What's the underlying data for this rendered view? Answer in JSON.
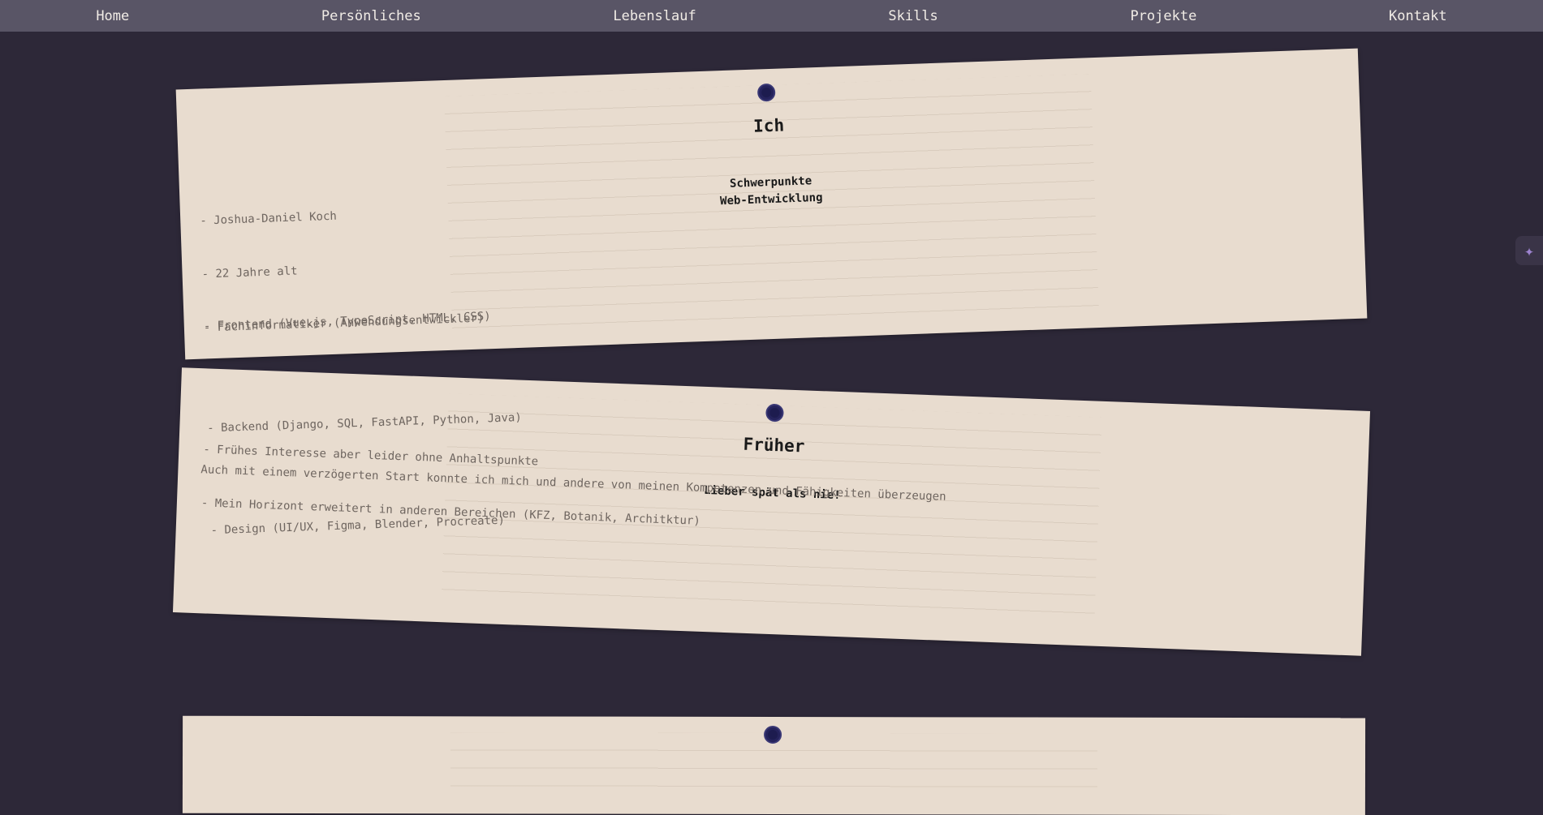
{
  "nav": {
    "home": "Home",
    "personal": "Persönliches",
    "cv": "Lebenslauf",
    "skills": "Skills",
    "projects": "Projekte",
    "contact": "Kontakt"
  },
  "card_ich": {
    "title": "Ich",
    "focus_label": "Schwerpunkte",
    "focus_value": "Web-Entwicklung",
    "info": [
      "- Joshua-Daniel Koch",
      "- 22 Jahre alt",
      "- Fachinformatiker (Anwendungsentwickler)"
    ],
    "skills": [
      "- Frontend (Vue.js, TypeScript, HTML, CSS)",
      "- Backend (Django, SQL, FastAPI, Python, Java)",
      "- Design (UI/UX, Figma, Blender, Procreate)"
    ]
  },
  "card_frueher": {
    "title": "Früher",
    "subtitle": "Lieber spät als nie!",
    "points": [
      "- Frühes Interesse aber leider ohne Anhaltspunkte",
      "- Mein Horizont erweitert in anderen Bereichen (KFZ, Botanik, Architktur)"
    ],
    "summary": "Auch mit einem verzögerten Start konnte ich mich und andere von meinen Kompetenzen und Fähigkeiten überzeugen"
  },
  "icons": {
    "pin": "pin-icon",
    "sparkle": "sparkle-icon",
    "sparkle_glyph": "✦"
  },
  "colors": {
    "background": "#2d2838",
    "navbar": "#595566",
    "card": "#e8dccf",
    "pin": "#1d1c4f",
    "sparkle": "#9d83cf"
  }
}
